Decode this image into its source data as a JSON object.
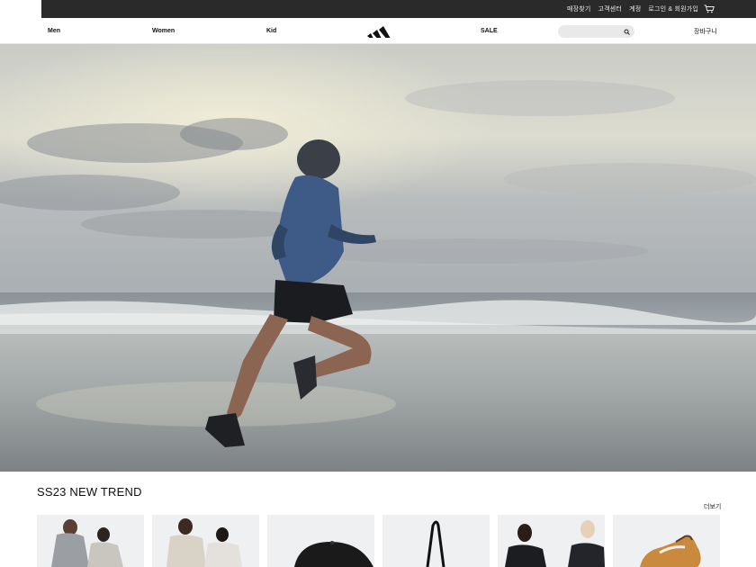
{
  "topbar": {
    "links": [
      "매장찾기",
      "고객센터",
      "계정",
      "로그인 & 회원가입"
    ],
    "cart_icon": "cart-icon"
  },
  "nav": {
    "men": "Men",
    "women": "Women",
    "kid": "Kid",
    "sale": "SALE",
    "cart": "장바구니",
    "logo_icon": "adidas-logo-icon",
    "search_icon": "search-icon",
    "search_placeholder": ""
  },
  "section": {
    "title": "SS23 NEW TREND",
    "more": "더보기"
  },
  "products": [
    {
      "name": "hoodie-duo"
    },
    {
      "name": "sweatshirt-duo"
    },
    {
      "name": "black-cap"
    },
    {
      "name": "tote-bag"
    },
    {
      "name": "jacket-duo"
    },
    {
      "name": "sneaker"
    }
  ],
  "colors": {
    "topbar_bg": "#2a2a2a",
    "accent": "#111111",
    "card_bg": "#eef0f1"
  }
}
